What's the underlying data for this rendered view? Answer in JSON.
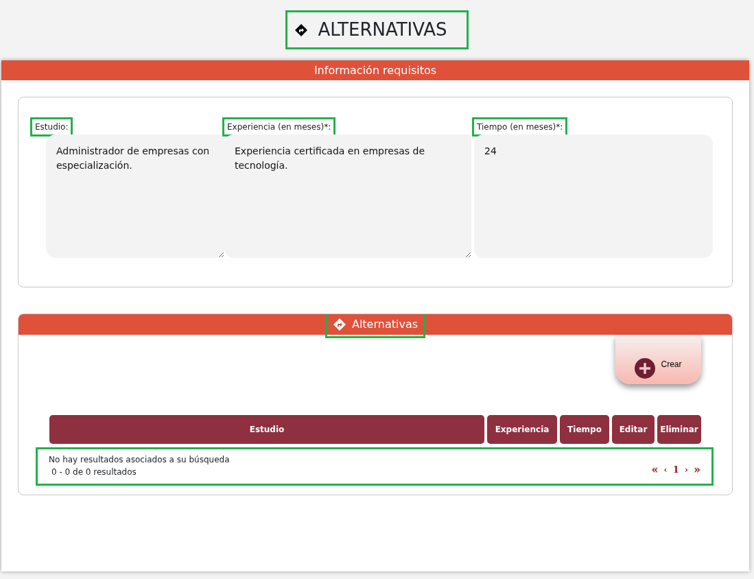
{
  "page_title": {
    "text": "ALTERNATIVAS",
    "highlighted": true
  },
  "requirements": {
    "title": "Información requisitos",
    "fields": [
      {
        "label": "Estudio:",
        "value": "Administrador de empresas con especialización.",
        "resizable": true,
        "highlighted": true
      },
      {
        "label": "Experiencia (en meses)*:",
        "value": "Experiencia certificada en empresas de tecnología.",
        "resizable": true,
        "highlighted": true
      },
      {
        "label": "Tiempo (en meses)*:",
        "value": "24",
        "resizable": false,
        "highlighted": true
      }
    ]
  },
  "alternatives": {
    "title": "Alternativas",
    "highlighted": true,
    "create_button": "Crear",
    "table": {
      "columns": [
        "Estudio",
        "Experiencia",
        "Tiempo",
        "Editar",
        "Eliminar"
      ]
    },
    "results": {
      "highlighted": true,
      "empty_message": "No hay resultados asociados a su búsqueda",
      "summary": "0 - 0 de 0 resultados",
      "pagination": [
        {
          "text": "«",
          "kind": "first"
        },
        {
          "text": "‹",
          "kind": "prev"
        },
        {
          "text": "1",
          "kind": "page"
        },
        {
          "text": "›",
          "kind": "next"
        },
        {
          "text": "»",
          "kind": "last"
        }
      ]
    }
  }
}
